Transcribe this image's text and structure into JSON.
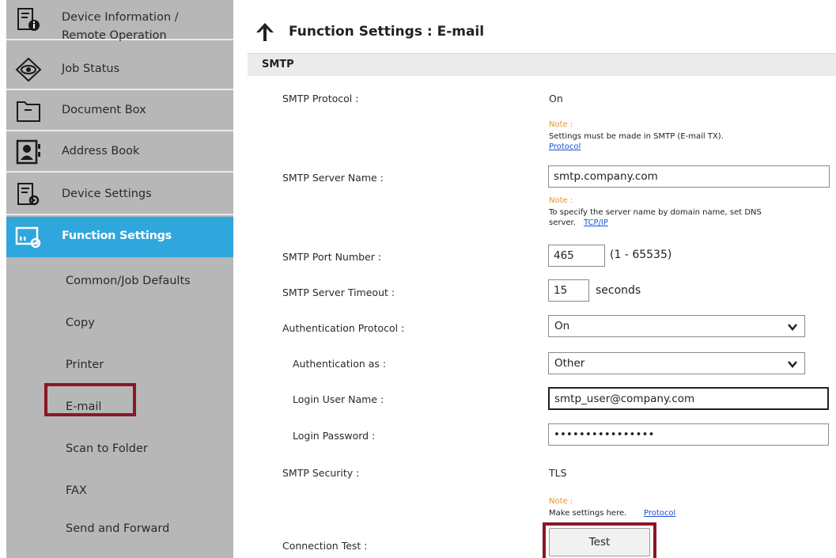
{
  "sidebar": {
    "main_items": [
      {
        "label_line1": "Device Information /",
        "label_line2": "Remote Operation",
        "icon": "device-info-icon"
      },
      {
        "label": "Job Status",
        "icon": "eye-icon"
      },
      {
        "label": "Document Box",
        "icon": "document-box-icon"
      },
      {
        "label": "Address Book",
        "icon": "address-book-icon"
      },
      {
        "label": "Device Settings",
        "icon": "device-settings-icon"
      },
      {
        "label": "Function Settings",
        "icon": "function-settings-icon"
      }
    ],
    "sub_items": [
      {
        "label": "Common/Job Defaults"
      },
      {
        "label": "Copy"
      },
      {
        "label": "Printer"
      },
      {
        "label": "E-mail"
      },
      {
        "label": "Scan to Folder"
      },
      {
        "label": "FAX"
      },
      {
        "label": "Send and Forward"
      }
    ],
    "active_main": "Function Settings",
    "active_sub": "E-mail"
  },
  "header": {
    "title": "Function Settings : E-mail",
    "up_icon": "arrow-up-icon"
  },
  "section": {
    "title": "SMTP"
  },
  "form": {
    "smtp_protocol": {
      "label": "SMTP Protocol :",
      "value": "On"
    },
    "note1": {
      "title": "Note :",
      "text": "Settings must be made in SMTP (E-mail TX).",
      "link": "Protocol"
    },
    "smtp_server_name": {
      "label": "SMTP Server Name :",
      "value": "smtp.company.com"
    },
    "note2": {
      "title": "Note :",
      "text_line1": "To specify the server name by domain name, set DNS",
      "text_line2": "server.",
      "link": "TCP/IP"
    },
    "smtp_port": {
      "label": "SMTP Port Number :",
      "value": "465",
      "range": "(1 - 65535)"
    },
    "smtp_timeout": {
      "label": "SMTP Server Timeout :",
      "value": "15",
      "unit": "seconds"
    },
    "auth_protocol": {
      "label": "Authentication Protocol :",
      "value": "On"
    },
    "auth_as": {
      "label": "Authentication as :",
      "value": "Other"
    },
    "login_user": {
      "label": "Login User Name :",
      "value": "smtp_user@company.com"
    },
    "login_password": {
      "label": "Login Password :",
      "value": "••••••••••••••••"
    },
    "smtp_security": {
      "label": "SMTP Security :",
      "value": "TLS"
    },
    "note3": {
      "title": "Note :",
      "text": "Make settings here.",
      "link": "Protocol"
    },
    "connection_test": {
      "label": "Connection Test :",
      "button": "Test"
    }
  },
  "colors": {
    "sidebar_bg": "#b7b7b7",
    "active_bg": "#2fa6dc",
    "highlight": "#8a1726",
    "note_title": "#e8932a",
    "link": "#1a4fd6"
  }
}
